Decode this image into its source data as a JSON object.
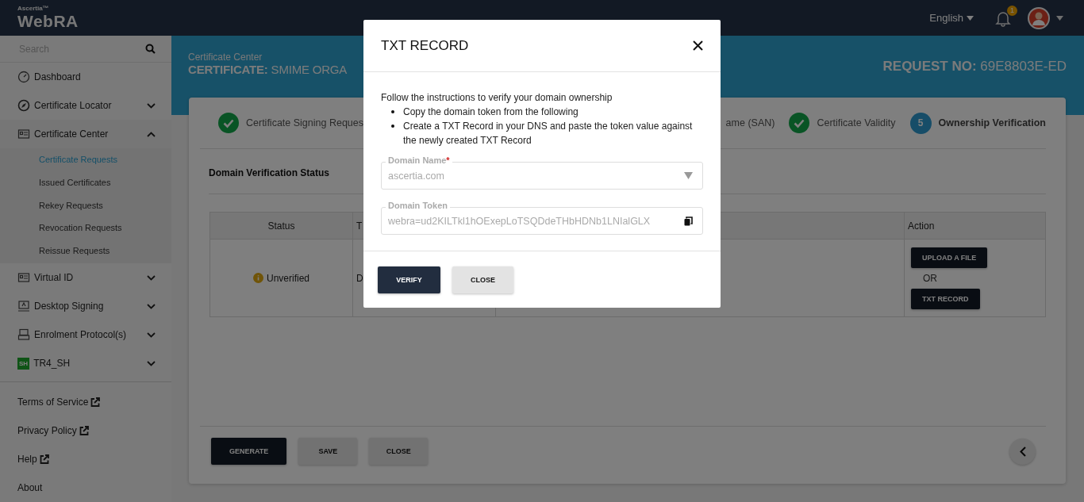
{
  "topbar": {
    "brand_small": "Ascertia™",
    "brand": "WebRA",
    "language": "English",
    "notification_count": "1"
  },
  "sidebar": {
    "search": {
      "placeholder": "Search"
    },
    "items": [
      {
        "label": "Dashboard"
      },
      {
        "label": "Certificate Locator",
        "expanded": false
      },
      {
        "label": "Certificate Center",
        "expanded": true,
        "children": [
          {
            "label": "Certificate Requests",
            "selected": true
          },
          {
            "label": "Issued Certificates",
            "selected": false
          },
          {
            "label": "Rekey Requests",
            "selected": false
          },
          {
            "label": "Revocation Requests",
            "selected": false
          },
          {
            "label": "Reissue Requests",
            "selected": false
          }
        ]
      },
      {
        "label": "Virtual ID",
        "expanded": false
      },
      {
        "label": "Desktop Signing",
        "expanded": false
      },
      {
        "label": "Enrolment Protocol(s)",
        "expanded": false
      },
      {
        "label": "TR4_SH",
        "expanded": false,
        "icon_text": "SH"
      }
    ],
    "footer_links": [
      {
        "label": "Terms of Service",
        "external": true
      },
      {
        "label": "Privacy Policy",
        "external": true
      },
      {
        "label": "Help",
        "external": true
      },
      {
        "label": "About",
        "external": false
      }
    ]
  },
  "header": {
    "section": "Certificate Center",
    "title": "**CERTIFICATE:** SMIME ORGA",
    "request": "**REQUEST NO:** 69E8803E-ED"
  },
  "steps": [
    {
      "label": "Certificate Signing Reques",
      "kind": "check"
    },
    {
      "label": "ame (SAN)"
    },
    {
      "label": "Certificate Validity",
      "kind": "check"
    },
    {
      "label": "Ownership Verification",
      "kind": "number",
      "number": "5"
    }
  ],
  "section_title": "Domain Verification Status",
  "table": {
    "columns": [
      "Status",
      "T",
      "Action"
    ],
    "rows": [
      {
        "status": "Unverified",
        "verified": false,
        "column_2": "D",
        "actions": [
          "UPLOAD A FILE",
          "TXT RECORD"
        ],
        "separator": "OR"
      }
    ]
  },
  "buttons": [
    {
      "label": "GENERATE",
      "primary": true
    },
    {
      "label": "SAVE",
      "primary": false
    },
    {
      "label": "CLOSE",
      "primary": false
    }
  ],
  "dialog": {
    "title": "TXT RECORD",
    "intro": "Follow the instructions to verify your domain ownership",
    "bullets": [
      "Copy the domain token from the following",
      "Create a TXT Record in your DNS and paste the token value against the newly created TXT Record"
    ],
    "fields": [
      {
        "label": "Domain Name",
        "required_mark": "*",
        "value": "ascertia.com",
        "kind": "select",
        "disabled": true
      },
      {
        "label": "Domain Token",
        "value": "webra=ud2KILTkl1hOExepLoTSQDdeTHbHDNb1LNIalGLX",
        "kind": "copy",
        "disabled": true
      }
    ],
    "buttons": [
      {
        "label": "VERIFY",
        "primary": true
      },
      {
        "label": "CLOSE",
        "primary": false
      }
    ]
  }
}
